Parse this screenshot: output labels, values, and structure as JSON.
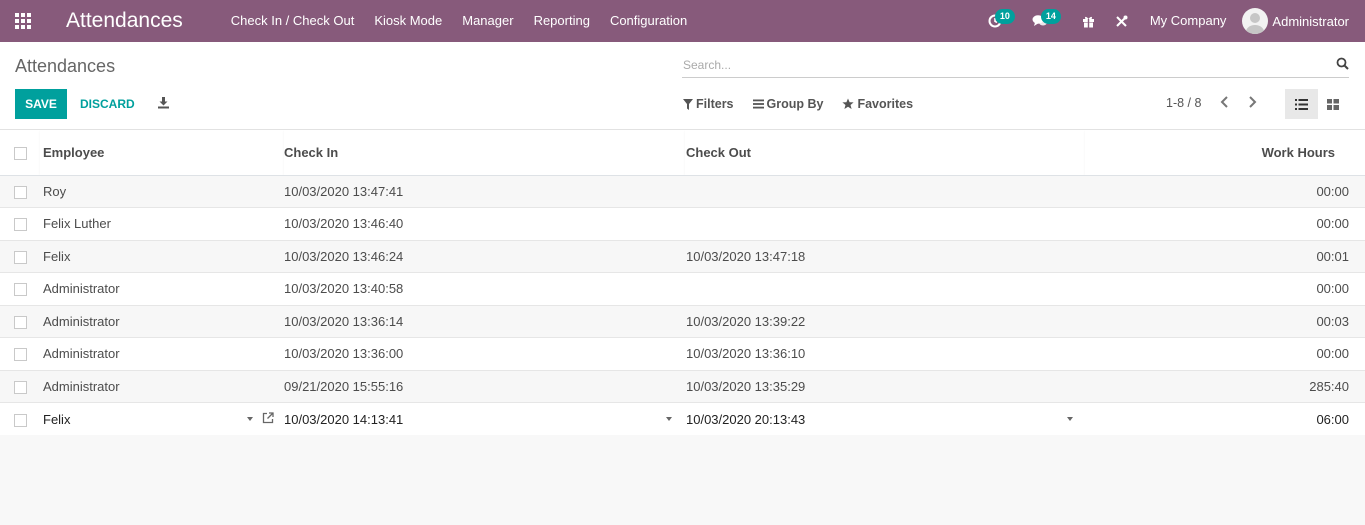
{
  "navbar": {
    "app_title": "Attendances",
    "menu": [
      "Check In / Check Out",
      "Kiosk Mode",
      "Manager",
      "Reporting",
      "Configuration"
    ],
    "activity_count": "10",
    "message_count": "14",
    "company": "My Company",
    "user": "Administrator"
  },
  "control_panel": {
    "breadcrumb": "Attendances",
    "search_placeholder": "Search...",
    "save_label": "SAVE",
    "discard_label": "DISCARD",
    "filters_label": "Filters",
    "groupby_label": "Group By",
    "favorites_label": "Favorites",
    "pager": "1-8 / 8"
  },
  "table": {
    "columns": [
      "Employee",
      "Check In",
      "Check Out",
      "Work Hours"
    ],
    "rows": [
      {
        "employee": "Roy",
        "check_in": "10/03/2020 13:47:41",
        "check_out": "",
        "hours": "00:00"
      },
      {
        "employee": "Felix Luther",
        "check_in": "10/03/2020 13:46:40",
        "check_out": "",
        "hours": "00:00"
      },
      {
        "employee": "Felix",
        "check_in": "10/03/2020 13:46:24",
        "check_out": "10/03/2020 13:47:18",
        "hours": "00:01"
      },
      {
        "employee": "Administrator",
        "check_in": "10/03/2020 13:40:58",
        "check_out": "",
        "hours": "00:00"
      },
      {
        "employee": "Administrator",
        "check_in": "10/03/2020 13:36:14",
        "check_out": "10/03/2020 13:39:22",
        "hours": "00:03"
      },
      {
        "employee": "Administrator",
        "check_in": "10/03/2020 13:36:00",
        "check_out": "10/03/2020 13:36:10",
        "hours": "00:00"
      },
      {
        "employee": "Administrator",
        "check_in": "09/21/2020 15:55:16",
        "check_out": "10/03/2020 13:35:29",
        "hours": "285:40"
      }
    ],
    "edit_row": {
      "employee": "Felix",
      "check_in": "10/03/2020 14:13:41",
      "check_out": "10/03/2020 20:13:43",
      "hours": "06:00"
    }
  }
}
